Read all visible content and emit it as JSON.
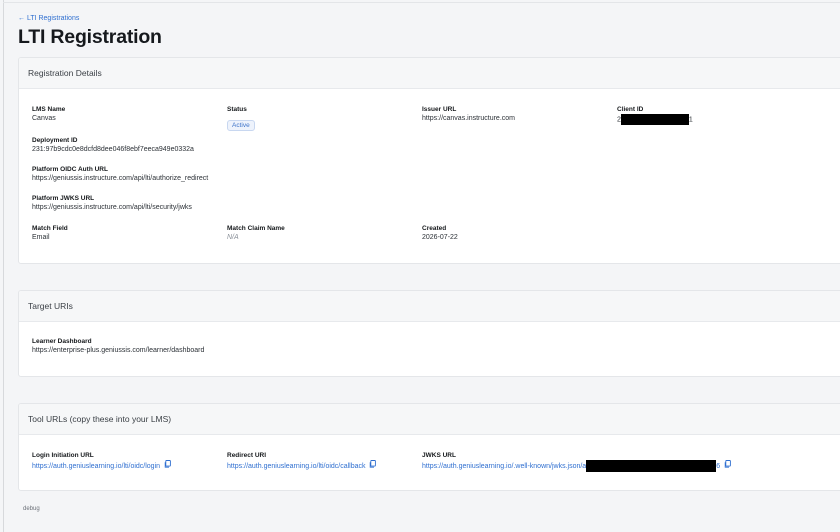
{
  "nav": {
    "back_label": "← LTI Registrations"
  },
  "page": {
    "title": "LTI Registration"
  },
  "registration": {
    "header": "Registration Details",
    "lms_name_label": "LMS Name",
    "lms_name": "Canvas",
    "status_label": "Status",
    "status": "Active",
    "issuer_url_label": "Issuer URL",
    "issuer_url": "https://canvas.instructure.com",
    "client_id_label": "Client ID",
    "client_id_prefix": "2",
    "client_id_suffix": "1",
    "deployment_id_label": "Deployment ID",
    "deployment_id": "231:97b9cdc0e8dcfd8dee046f8ebf7eeca949e0332a",
    "oidc_auth_url_label": "Platform OIDC Auth URL",
    "oidc_auth_url": "https://geniussis.instructure.com/api/lti/authorize_redirect",
    "jwks_url_label": "Platform JWKS URL",
    "jwks_url": "https://geniussis.instructure.com/api/lti/security/jwks",
    "match_field_label": "Match Field",
    "match_field": "Email",
    "match_claim_label": "Match Claim Name",
    "match_claim": "N/A",
    "created_label": "Created",
    "created": "2026-07-22"
  },
  "target": {
    "header": "Target URIs",
    "learner_dashboard_label": "Learner Dashboard",
    "learner_dashboard": "https://enterprise-plus.geniussis.com/learner/dashboard"
  },
  "tool": {
    "header": "Tool URLs (copy these into your LMS)",
    "login_label": "Login Initiation URL",
    "login_url": "https://auth.geniuslearning.io/lti/oidc/login",
    "redirect_label": "Redirect URI",
    "redirect_url": "https://auth.geniuslearning.io/lti/oidc/callback",
    "jwks_label": "JWKS URL",
    "jwks_prefix": "https://auth.geniuslearning.io/.well-known/jwks.json/a",
    "jwks_suffix": "6"
  },
  "footer": {
    "debug": "debug"
  },
  "colors": {
    "link": "#2f6fd0",
    "badge_bg": "#eef3fc",
    "page_bg": "#f4f5f7"
  },
  "icons": {
    "copy": "copy-icon"
  }
}
